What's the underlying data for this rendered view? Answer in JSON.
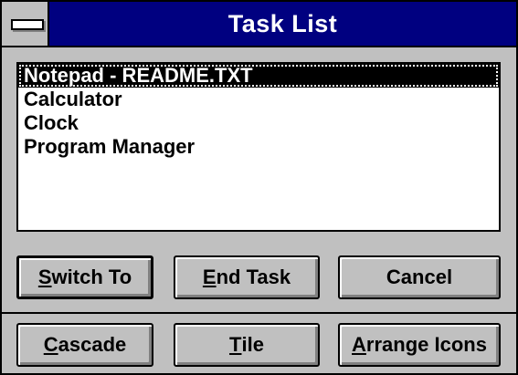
{
  "window": {
    "title": "Task List"
  },
  "task_list": {
    "items": [
      "Notepad - README.TXT",
      "Calculator",
      "Clock",
      "Program Manager"
    ],
    "selected_index": 0
  },
  "buttons": {
    "switch_to": {
      "mnemonic": "S",
      "rest": "witch To"
    },
    "end_task": {
      "mnemonic": "E",
      "rest": "nd Task"
    },
    "cancel": {
      "label": "Cancel"
    },
    "cascade": {
      "mnemonic": "C",
      "rest": "ascade"
    },
    "tile": {
      "mnemonic": "T",
      "rest": "ile"
    },
    "arrange_icons": {
      "mnemonic": "A",
      "rest": "rrange Icons"
    }
  },
  "colors": {
    "titlebar": "#000080",
    "face": "#c0c0c0",
    "selection": "#000000"
  },
  "icons": {
    "system_menu": "system-menu-icon"
  }
}
